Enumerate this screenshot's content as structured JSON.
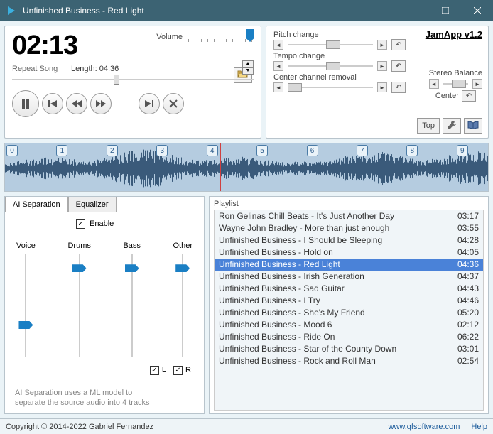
{
  "window": {
    "title": "Unfinished Business - Red Light"
  },
  "player": {
    "time": "02:13",
    "volume_label": "Volume",
    "repeat_label": "Repeat Song",
    "length_label": "Length:  04:36"
  },
  "effects": {
    "brand": "JamApp v1.2",
    "pitch_label": "Pitch change",
    "tempo_label": "Tempo change",
    "center_label": "Center channel removal",
    "balance_label": "Stereo Balance",
    "balance_center": "Center",
    "top_btn": "Top"
  },
  "markers": [
    "0",
    "1",
    "2",
    "3",
    "4",
    "5",
    "6",
    "7",
    "8",
    "9"
  ],
  "tabs": {
    "sep": "AI Separation",
    "eq": "Equalizer"
  },
  "sep": {
    "enable": "Enable",
    "voice": "Voice",
    "drums": "Drums",
    "bass": "Bass",
    "other": "Other",
    "L": "L",
    "R": "R",
    "hint1": "AI Separation uses a ML model to",
    "hint2": "separate the source audio into 4 tracks"
  },
  "playlist": {
    "title": "Playlist",
    "items": [
      {
        "name": "Ron Gelinas Chill Beats - It's Just Another Day",
        "dur": "03:17"
      },
      {
        "name": "Wayne John Bradley - More than just enough",
        "dur": "03:55"
      },
      {
        "name": "Unfinished Business - I Should be Sleeping",
        "dur": "04:28"
      },
      {
        "name": "Unfinished Business - Hold on",
        "dur": "04:05"
      },
      {
        "name": "Unfinished Business - Red Light",
        "dur": "04:36"
      },
      {
        "name": "Unfinished Business - Irish Generation",
        "dur": "04:37"
      },
      {
        "name": "Unfinished Business - Sad Guitar",
        "dur": "04:43"
      },
      {
        "name": "Unfinished Business - I Try",
        "dur": "04:46"
      },
      {
        "name": "Unfinished Business - She's My Friend",
        "dur": "05:20"
      },
      {
        "name": "Unfinished Business - Mood 6",
        "dur": "02:12"
      },
      {
        "name": "Unfinished Business - Ride On",
        "dur": "06:22"
      },
      {
        "name": "Unfinished Business - Star of the County Down",
        "dur": "03:01"
      },
      {
        "name": "Unfinished Business - Rock and Roll Man",
        "dur": "02:54"
      }
    ],
    "selected_index": 4
  },
  "footer": {
    "copyright": "Copyright © 2014-2022 Gabriel Fernandez",
    "url": "www.qfsoftware.com",
    "help": "Help"
  }
}
